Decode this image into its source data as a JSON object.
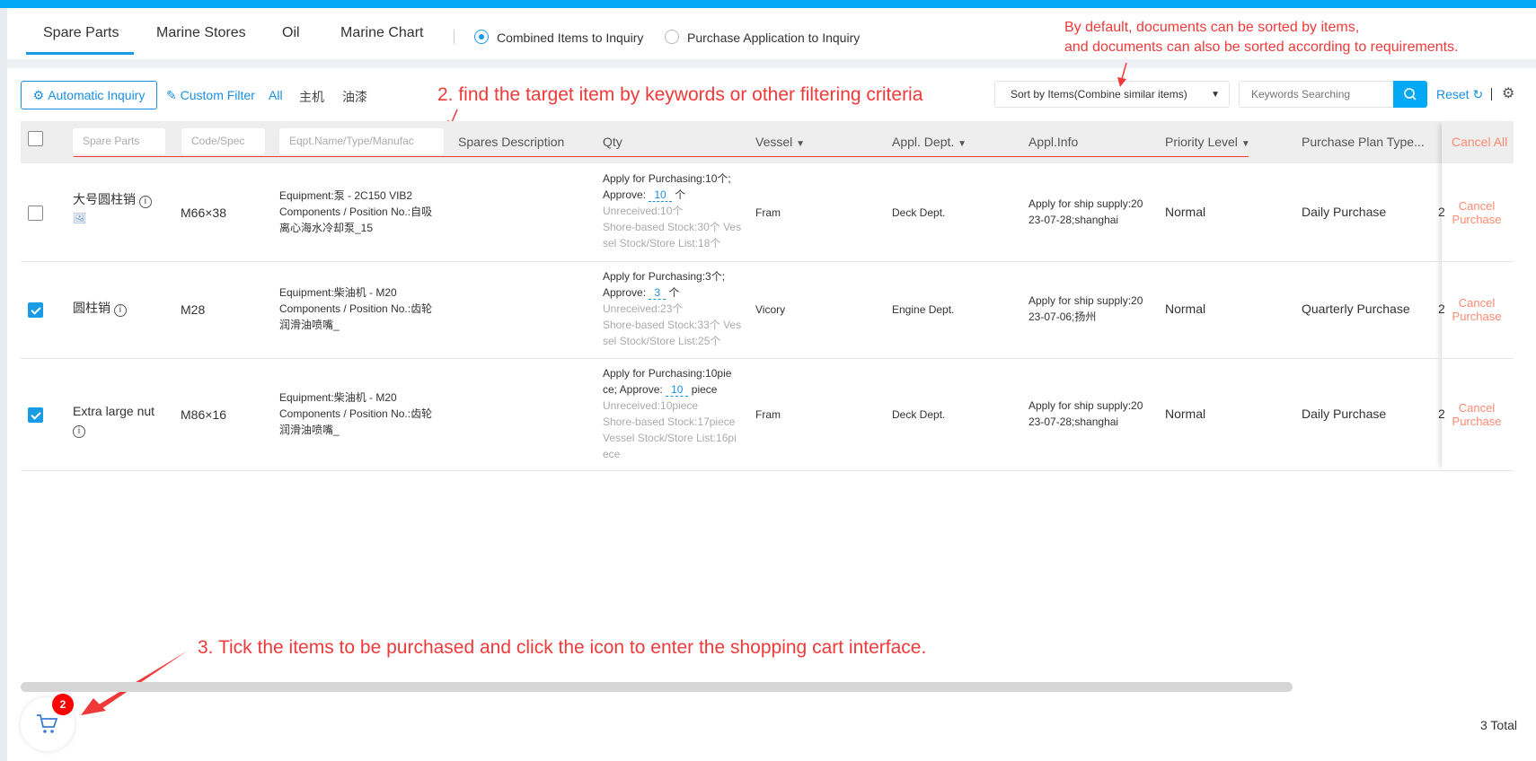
{
  "tabs": [
    {
      "label": "Spare Parts",
      "active": true
    },
    {
      "label": "Marine Stores"
    },
    {
      "label": "Oil"
    },
    {
      "label": "Marine Chart"
    }
  ],
  "modes": [
    {
      "label": "Combined Items to Inquiry",
      "selected": true
    },
    {
      "label": "Purchase Application to Inquiry",
      "selected": false
    }
  ],
  "toolbar": {
    "auto_inquiry": "Automatic Inquiry",
    "custom_filter": "Custom Filter",
    "filters": [
      "All",
      "主机",
      "油漆"
    ],
    "sort": "Sort by Items(Combine similar items)",
    "search_placeholder": "Keywords Searching",
    "reset": "Reset"
  },
  "header": {
    "filters": [
      "Spare Parts",
      "Code/Spec",
      "Eqpt.Name/Type/Manufac"
    ],
    "columns": [
      "Spares Description",
      "Qty",
      "Vessel",
      "Appl. Dept.",
      "Appl.Info",
      "Priority Level",
      "Purchase Plan Type..."
    ],
    "cancel_all": "Cancel All"
  },
  "rows": [
    {
      "checked": false,
      "name": "大号圆柱销",
      "code": "M66×38",
      "eq1": "Equipment:泵 - 2C150 VIB2",
      "eq2": "Components / Position No.:自吸",
      "eq3": "离心海水冷却泵_15",
      "q1": "Apply for Purchasing:10个;",
      "q2a": "Approve:",
      "q2n": "10",
      "q2u": "个",
      "q3": "Unreceived:10个",
      "q4": "Shore-based Stock:30个 Ves",
      "q5": "sel Stock/Store List:18个",
      "q6": "",
      "vessel": "Fram",
      "dept": "Deck Dept.",
      "info1": "Apply for ship supply:20",
      "info2": "23-07-28;shanghai",
      "priority": "Normal",
      "plan": "Daily Purchase",
      "extra": "2",
      "cancel": "Cancel Purchase"
    },
    {
      "checked": true,
      "name": "圆柱销",
      "code": "M28",
      "eq1": "Equipment:柴油机 - M20",
      "eq2": "Components / Position No.:齿轮",
      "eq3": "润滑油喷嘴_",
      "q1": "Apply for Purchasing:3个;",
      "q2a": "Approve:",
      "q2n": "3",
      "q2u": "个",
      "q3": "Unreceived:23个",
      "q4": "Shore-based Stock:33个 Ves",
      "q5": "sel Stock/Store List:25个",
      "q6": "",
      "vessel": "Vicory",
      "dept": "Engine Dept.",
      "info1": "Apply for ship supply:20",
      "info2": "23-07-06;扬州",
      "priority": "Normal",
      "plan": "Quarterly Purchase",
      "extra": "2",
      "cancel": "Cancel Purchase"
    },
    {
      "checked": true,
      "name": "Extra large nut",
      "code": "M86×16",
      "eq1": "Equipment:柴油机 - M20",
      "eq2": "Components / Position No.:齿轮",
      "eq3": "润滑油喷嘴_",
      "q1": "Apply for Purchasing:10pie",
      "q2a": "ce; Approve:",
      "q2n": "10",
      "q2u": "piece",
      "q3": "Unreceived:10piece",
      "q4": "Shore-based Stock:17piece",
      "q5": "Vessel Stock/Store List:16pi",
      "q6": "ece",
      "vessel": "Fram",
      "dept": "Deck Dept.",
      "info1": "Apply for ship supply:20",
      "info2": "23-07-28;shanghai",
      "priority": "Normal",
      "plan": "Daily Purchase",
      "extra": "2",
      "cancel": "Cancel Purchase"
    }
  ],
  "cart": {
    "count": "2"
  },
  "footer": {
    "total": "3 Total"
  },
  "annotations": {
    "a1a": "By default, documents can be sorted by items,",
    "a1b": "and documents can also be sorted according to requirements.",
    "a2": "2. find the target item by keywords or other filtering criteria",
    "a3": "3. Tick the items to be purchased and click the icon to enter the shopping cart interface."
  },
  "colors": {
    "accent": "#03a9f4",
    "link": "#1a8fe0",
    "annotation": "#f03a3a",
    "cancel": "#ff8a70",
    "badge": "#ff0000"
  }
}
